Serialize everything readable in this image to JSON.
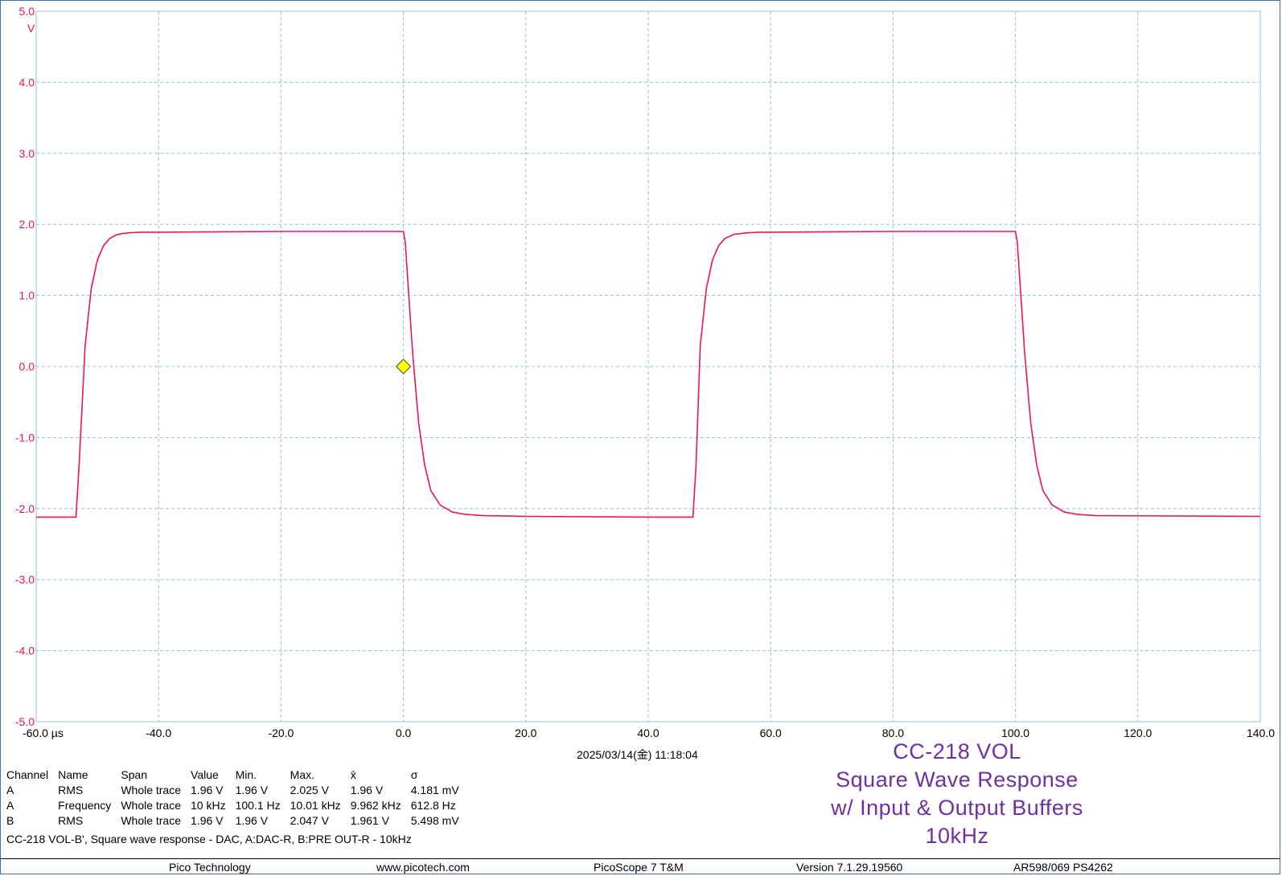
{
  "chart_data": {
    "type": "line",
    "xlabel_unit": "µs",
    "ylabel_unit": "V",
    "xlim": [
      -60,
      140
    ],
    "ylim": [
      -5,
      5
    ],
    "grid": true,
    "x_ticks": [
      "-60.0 µs",
      "-40.0",
      "-20.0",
      "0.0",
      "20.0",
      "40.0",
      "60.0",
      "80.0",
      "100.0",
      "120.0",
      "140.0"
    ],
    "y_ticks": [
      "5.0",
      "4.0",
      "3.0",
      "2.0",
      "1.0",
      "0.0",
      "-1.0",
      "-2.0",
      "-3.0",
      "-4.0",
      "-5.0"
    ],
    "series": [
      {
        "color": "#e8174f",
        "x": [
          -60,
          -53.5,
          -53,
          -52,
          -51,
          -50,
          -49,
          -48,
          -47,
          -46,
          -45,
          -43,
          -40,
          -20,
          0,
          0.3,
          0.8,
          1.5,
          2.5,
          3.5,
          4.5,
          6,
          8,
          10,
          13,
          20,
          40,
          47.3,
          47.8,
          48.5,
          49.5,
          50.5,
          51.5,
          52.5,
          54,
          56,
          58,
          60,
          80,
          100,
          100.3,
          100.8,
          101.5,
          102.5,
          103.5,
          104.5,
          106,
          108,
          110,
          113,
          140
        ],
        "y": [
          -2.12,
          -2.12,
          -1.4,
          0.3,
          1.1,
          1.5,
          1.7,
          1.8,
          1.85,
          1.87,
          1.88,
          1.89,
          1.89,
          1.9,
          1.9,
          1.75,
          1.1,
          0.2,
          -0.8,
          -1.4,
          -1.75,
          -1.95,
          -2.05,
          -2.08,
          -2.1,
          -2.11,
          -2.12,
          -2.12,
          -1.4,
          0.3,
          1.1,
          1.5,
          1.7,
          1.8,
          1.86,
          1.88,
          1.89,
          1.89,
          1.9,
          1.9,
          1.75,
          1.1,
          0.2,
          -0.8,
          -1.4,
          -1.75,
          -1.95,
          -2.05,
          -2.08,
          -2.1,
          -2.11
        ]
      }
    ],
    "trigger_marker": {
      "x": 0,
      "y": 0
    }
  },
  "timestamp": "2025/03/14(金) 11:18:04",
  "measurements": {
    "headers": [
      "Channel",
      "Name",
      "Span",
      "Value",
      "Min.",
      "Max.",
      "x̄",
      "σ"
    ],
    "rows": [
      [
        "A",
        "RMS",
        "Whole trace",
        "1.96 V",
        "1.96 V",
        "2.025 V",
        "1.96 V",
        "4.181 mV"
      ],
      [
        "A",
        "Frequency",
        "Whole trace",
        "10 kHz",
        "100.1 Hz",
        "10.01 kHz",
        "9.962 kHz",
        "612.8 Hz"
      ],
      [
        "B",
        "RMS",
        "Whole trace",
        "1.96 V",
        "1.96 V",
        "2.047 V",
        "1.961 V",
        "5.498 mV"
      ]
    ]
  },
  "caption": "CC-218 VOL-B', Square wave response - DAC, A:DAC-R, B:PRE OUT-R - 10kHz",
  "annotation": {
    "lines": [
      "CC-218 VOL",
      "Square Wave Response",
      "w/ Input & Output Buffers",
      "10kHz"
    ],
    "color": "#7030a0"
  },
  "footer": {
    "company": "Pico Technology",
    "website": "www.picotech.com",
    "product": "PicoScope 7 T&M",
    "version": "Version 7.1.29.19560",
    "device": "AR598/069 PS4262"
  },
  "colors": {
    "trace": "#e8174f",
    "grid": "#8fc3e0",
    "trigger": "#ffff00"
  }
}
